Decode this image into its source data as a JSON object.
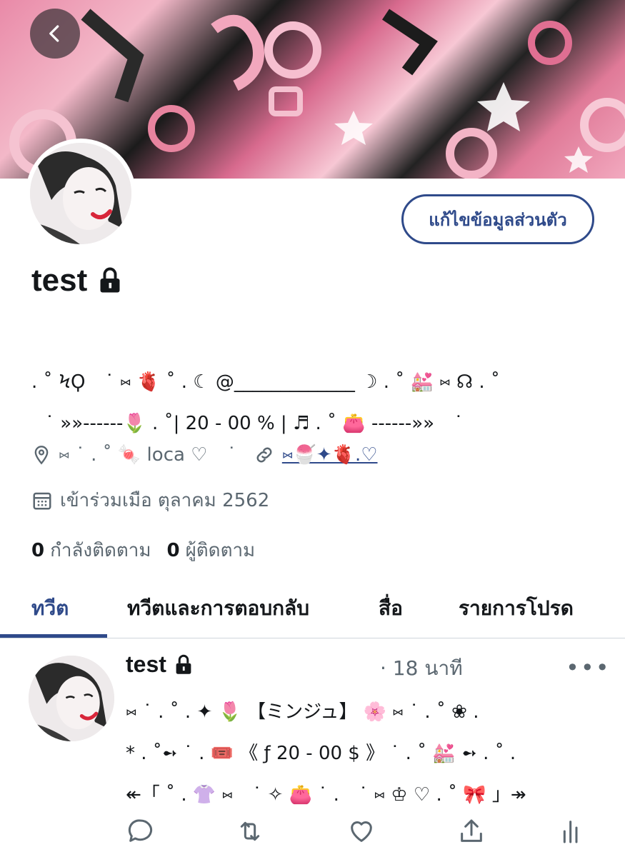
{
  "header": {
    "back_icon": "chevron-left-icon"
  },
  "profile": {
    "edit_button_label": "แก้ไขข้อมูลส่วนตัว",
    "display_name": "test",
    "locked_icon": "lock-icon",
    "bio_lines": [
      ". ˚ ϞϘ ⠀˙ ⑅ 🫀 ˚ . ☾ @_____________ ☽ . ˚ 💒 ⑅ ☊ . ˚",
      "⠀˙ »»------🌷 . ˚| 20 - 00 % | ♬ . ˚ 👛 ------»» ⠀˙"
    ],
    "bio_link": "@_____________",
    "location": "⑅ ˙ . ˚ 🍬 loca ♡ ⠀˙",
    "website": "⑅🍧✦🫀.♡",
    "joined": "เข้าร่วมเมือ ตุลาคม 2562",
    "following_count": "0",
    "following_label": "กำลังติดตาม",
    "followers_count": "0",
    "followers_label": "ผู้ติดตาม"
  },
  "tabs": [
    {
      "label": "ทวีต",
      "active": true
    },
    {
      "label": "ทวีตและการตอบกลับ",
      "active": false
    },
    {
      "label": "สื่อ",
      "active": false
    },
    {
      "label": "รายการโปรด",
      "active": false
    }
  ],
  "tweet": {
    "name": "test",
    "time": "· 18 นาที",
    "more_label": "•••",
    "lines": [
      "⑅ ˙ . ˚ . ✦ 🌷 【ミンジュ】 🌸 ⑅ ˙ . ˚ ❀ .",
      "* . ˚➻ ˙ . 🎟️ 《 ƒ 20 - 00 $ 》 ˙ . ˚ 💒 ➻ . ˚ .",
      "↞「 ˚ . 👚 ⑅ ⠀˙ ✧ 👛 ˙ . ⠀˙ ⑅ ♔ ♡ . ˚ 🎀 」↠"
    ],
    "actions": [
      "reply-icon",
      "retweet-icon",
      "like-icon",
      "share-icon",
      "analytics-icon"
    ]
  },
  "colors": {
    "accent": "#2f4a8a",
    "text": "#14171a",
    "secondary": "#5b6770",
    "divider": "#cfd6dc"
  }
}
